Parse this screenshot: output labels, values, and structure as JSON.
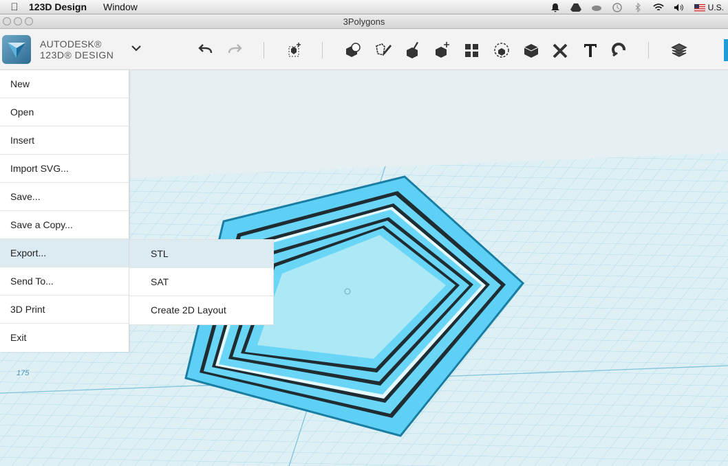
{
  "menubar": {
    "app_name": "123D Design",
    "menus": [
      "Window"
    ],
    "input_source": "U.S."
  },
  "window": {
    "title": "3Polygons"
  },
  "brand": {
    "line1": "AUTODESK®",
    "line2": "123D® DESIGN"
  },
  "toolbar": {
    "icons": [
      "undo-icon",
      "redo-icon",
      "transform-icon",
      "primitives-icon",
      "sketch-icon",
      "construct-icon",
      "modify-icon",
      "pattern-icon",
      "group-icon",
      "combine-icon",
      "measure-icon",
      "text-icon",
      "snap-icon",
      "materials-icon"
    ]
  },
  "file_menu": {
    "items": [
      {
        "label": "New"
      },
      {
        "label": "Open"
      },
      {
        "label": "Insert"
      },
      {
        "label": "Import SVG..."
      },
      {
        "label": "Save..."
      },
      {
        "label": "Save a Copy..."
      },
      {
        "label": "Export..."
      },
      {
        "label": "Send To..."
      },
      {
        "label": "3D Print"
      },
      {
        "label": "Exit"
      }
    ],
    "active_item": "Export..."
  },
  "export_submenu": {
    "items": [
      {
        "label": "STL"
      },
      {
        "label": "SAT"
      },
      {
        "label": "Create 2D Layout"
      }
    ]
  },
  "viewport": {
    "grid_label": "175"
  },
  "colors": {
    "accent": "#1f9bd8",
    "model": "#5fd0f5",
    "grid": "#9fd6e8",
    "menu_hover": "#dcebf2"
  }
}
